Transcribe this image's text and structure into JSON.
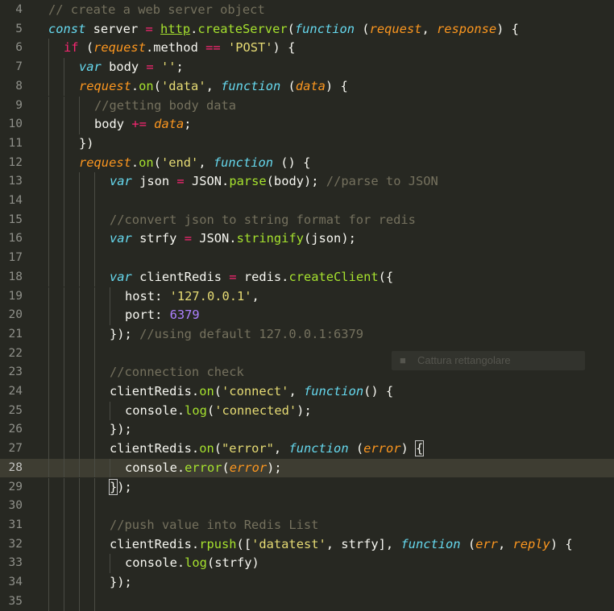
{
  "editor": {
    "theme": "monokai",
    "active_line": 28,
    "lines": [
      {
        "n": "4",
        "indent": 0,
        "tokens": [
          [
            "com",
            "// create a web server object"
          ]
        ]
      },
      {
        "n": "5",
        "indent": 0,
        "tokens": [
          [
            "kw",
            "const"
          ],
          [
            "var",
            " server "
          ],
          [
            "op",
            "="
          ],
          [
            "var",
            " "
          ],
          [
            "ul",
            "http"
          ],
          [
            "var",
            "."
          ],
          [
            "fn",
            "createServer"
          ],
          [
            "var",
            "("
          ],
          [
            "kw",
            "function"
          ],
          [
            "var",
            " ("
          ],
          [
            "par",
            "request"
          ],
          [
            "var",
            ", "
          ],
          [
            "par",
            "response"
          ],
          [
            "var",
            ") {"
          ]
        ]
      },
      {
        "n": "6",
        "indent": 1,
        "tokens": [
          [
            "kw2",
            "if"
          ],
          [
            "var",
            " ("
          ],
          [
            "par",
            "request"
          ],
          [
            "var",
            ".method "
          ],
          [
            "op",
            "=="
          ],
          [
            "var",
            " "
          ],
          [
            "str",
            "'POST'"
          ],
          [
            "var",
            ") {"
          ]
        ]
      },
      {
        "n": "7",
        "indent": 2,
        "tokens": [
          [
            "kw",
            "var"
          ],
          [
            "var",
            " body "
          ],
          [
            "op",
            "="
          ],
          [
            "var",
            " "
          ],
          [
            "str",
            "''"
          ],
          [
            "var",
            ";"
          ]
        ]
      },
      {
        "n": "8",
        "indent": 2,
        "tokens": [
          [
            "par",
            "request"
          ],
          [
            "var",
            "."
          ],
          [
            "fn",
            "on"
          ],
          [
            "var",
            "("
          ],
          [
            "str",
            "'data'"
          ],
          [
            "var",
            ", "
          ],
          [
            "kw",
            "function"
          ],
          [
            "var",
            " ("
          ],
          [
            "par",
            "data"
          ],
          [
            "var",
            ") {"
          ]
        ]
      },
      {
        "n": "9",
        "indent": 3,
        "tokens": [
          [
            "com",
            "//getting body data"
          ]
        ]
      },
      {
        "n": "10",
        "indent": 3,
        "tokens": [
          [
            "var",
            "body "
          ],
          [
            "op",
            "+="
          ],
          [
            "var",
            " "
          ],
          [
            "par",
            "data"
          ],
          [
            "var",
            ";"
          ]
        ]
      },
      {
        "n": "11",
        "indent": 2,
        "tokens": [
          [
            "var",
            "})"
          ]
        ]
      },
      {
        "n": "12",
        "indent": 2,
        "tokens": [
          [
            "par",
            "request"
          ],
          [
            "var",
            "."
          ],
          [
            "fn",
            "on"
          ],
          [
            "var",
            "("
          ],
          [
            "str",
            "'end'"
          ],
          [
            "var",
            ", "
          ],
          [
            "kw",
            "function"
          ],
          [
            "var",
            " () {"
          ]
        ]
      },
      {
        "n": "13",
        "indent": 4,
        "tokens": [
          [
            "kw",
            "var"
          ],
          [
            "var",
            " json "
          ],
          [
            "op",
            "="
          ],
          [
            "var",
            " JSON."
          ],
          [
            "fn",
            "parse"
          ],
          [
            "var",
            "(body); "
          ],
          [
            "com",
            "//parse to JSON"
          ]
        ]
      },
      {
        "n": "14",
        "indent": 4,
        "tokens": []
      },
      {
        "n": "15",
        "indent": 4,
        "tokens": [
          [
            "com",
            "//convert json to string format for redis"
          ]
        ]
      },
      {
        "n": "16",
        "indent": 4,
        "tokens": [
          [
            "kw",
            "var"
          ],
          [
            "var",
            " strfy "
          ],
          [
            "op",
            "="
          ],
          [
            "var",
            " JSON."
          ],
          [
            "fn",
            "stringify"
          ],
          [
            "var",
            "(json);"
          ]
        ]
      },
      {
        "n": "17",
        "indent": 4,
        "tokens": []
      },
      {
        "n": "18",
        "indent": 4,
        "tokens": [
          [
            "kw",
            "var"
          ],
          [
            "var",
            " clientRedis "
          ],
          [
            "op",
            "="
          ],
          [
            "var",
            " redis."
          ],
          [
            "fn",
            "createClient"
          ],
          [
            "var",
            "({"
          ]
        ]
      },
      {
        "n": "19",
        "indent": 5,
        "tokens": [
          [
            "var",
            "host: "
          ],
          [
            "str",
            "'127.0.0.1'"
          ],
          [
            "var",
            ","
          ]
        ]
      },
      {
        "n": "20",
        "indent": 5,
        "tokens": [
          [
            "var",
            "port: "
          ],
          [
            "num",
            "6379"
          ]
        ]
      },
      {
        "n": "21",
        "indent": 4,
        "tokens": [
          [
            "var",
            "}); "
          ],
          [
            "com",
            "//using default 127.0.0.1:6379"
          ]
        ]
      },
      {
        "n": "22",
        "indent": 4,
        "tokens": []
      },
      {
        "n": "23",
        "indent": 4,
        "tokens": [
          [
            "com",
            "//connection check"
          ]
        ]
      },
      {
        "n": "24",
        "indent": 4,
        "tokens": [
          [
            "var",
            "clientRedis."
          ],
          [
            "fn",
            "on"
          ],
          [
            "var",
            "("
          ],
          [
            "str",
            "'connect'"
          ],
          [
            "var",
            ", "
          ],
          [
            "kw",
            "function"
          ],
          [
            "var",
            "() {"
          ]
        ]
      },
      {
        "n": "25",
        "indent": 5,
        "tokens": [
          [
            "var",
            "console."
          ],
          [
            "fn",
            "log"
          ],
          [
            "var",
            "("
          ],
          [
            "str",
            "'connected'"
          ],
          [
            "var",
            ");"
          ]
        ]
      },
      {
        "n": "26",
        "indent": 4,
        "tokens": [
          [
            "var",
            "});"
          ]
        ]
      },
      {
        "n": "27",
        "indent": 4,
        "tokens": [
          [
            "var",
            "clientRedis."
          ],
          [
            "fn",
            "on"
          ],
          [
            "var",
            "("
          ],
          [
            "str",
            "\"error\""
          ],
          [
            "var",
            ", "
          ],
          [
            "kw",
            "function"
          ],
          [
            "var",
            " ("
          ],
          [
            "par",
            "error"
          ],
          [
            "var",
            ") "
          ],
          [
            "box",
            "{"
          ]
        ]
      },
      {
        "n": "28",
        "indent": 5,
        "tokens": [
          [
            "var",
            "console."
          ],
          [
            "fn",
            "error"
          ],
          [
            "var",
            "("
          ],
          [
            "par",
            "error"
          ],
          [
            "var",
            ");"
          ]
        ]
      },
      {
        "n": "29",
        "indent": 4,
        "tokens": [
          [
            "box",
            "}"
          ],
          [
            "var",
            ");"
          ]
        ]
      },
      {
        "n": "30",
        "indent": 4,
        "tokens": []
      },
      {
        "n": "31",
        "indent": 4,
        "tokens": [
          [
            "com",
            "//push value into Redis List"
          ]
        ]
      },
      {
        "n": "32",
        "indent": 4,
        "tokens": [
          [
            "var",
            "clientRedis."
          ],
          [
            "fn",
            "rpush"
          ],
          [
            "var",
            "(["
          ],
          [
            "str",
            "'datatest'"
          ],
          [
            "var",
            ", strfy], "
          ],
          [
            "kw",
            "function"
          ],
          [
            "var",
            " ("
          ],
          [
            "par",
            "err"
          ],
          [
            "var",
            ", "
          ],
          [
            "par",
            "reply"
          ],
          [
            "var",
            ") {"
          ]
        ]
      },
      {
        "n": "33",
        "indent": 5,
        "tokens": [
          [
            "var",
            "console."
          ],
          [
            "fn",
            "log"
          ],
          [
            "var",
            "(strfy)"
          ]
        ]
      },
      {
        "n": "34",
        "indent": 4,
        "tokens": [
          [
            "var",
            "});"
          ]
        ]
      },
      {
        "n": "35",
        "indent": 4,
        "tokens": []
      }
    ]
  },
  "overlay": {
    "icon": "capture-icon",
    "label": "Cattura rettangolare"
  },
  "colors": {
    "background": "#272822",
    "active_line": "#3e3d32",
    "comment": "#75715e",
    "keyword": "#66d9ef",
    "operator": "#f92672",
    "string": "#e6db74",
    "number": "#ae81ff",
    "function": "#a6e22e",
    "parameter": "#fd971f"
  }
}
